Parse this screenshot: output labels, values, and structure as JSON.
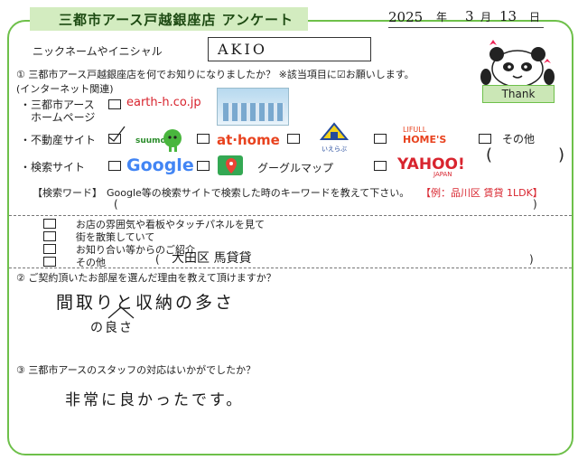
{
  "header": {
    "title": "三都市アース戸越銀座店 アンケート",
    "date_year": "2025",
    "date_year_unit": "年",
    "date_month": "3",
    "date_month_unit": "月",
    "date_day": "13",
    "date_day_unit": "日"
  },
  "nickname": {
    "label": "ニックネームやイニシャル",
    "value": "AKIO"
  },
  "mascot": {
    "badge": "Thank"
  },
  "q1": {
    "question": "① 三都市アース戸越銀座店を何でお知りになりましたか？ ※該当項目に☑お願いします。",
    "internet_label": "(インターネット関連)",
    "homepage_label_1": "・三都市アース",
    "homepage_label_2": "ホームページ",
    "homepage_site": "earth-h.co.jp",
    "realestate_label": "・不動産サイト",
    "suumo": "suumo",
    "athome": "at·home",
    "ieichi": "いえらぶ",
    "lifull_1": "LIFULL",
    "lifull_2": "HOME'S",
    "other_label": "その他",
    "paren_open": "(",
    "paren_close": ")",
    "search_label": "・検索サイト",
    "google": "Google",
    "googlemap": "グーグルマップ",
    "yahoo": "YAHOO!",
    "yahoo_sub": "JAPAN",
    "keyword_label": "【検索ワード】",
    "keyword_desc": "Google等の検索サイトで検索した時のキーワードを教えて下さい。",
    "keyword_example": "【例：品川区 賃貸 1LDK】",
    "offline": [
      {
        "label": "お店の雰囲気や看板やタッチパネルを見て"
      },
      {
        "label": "街を散策していて"
      },
      {
        "label": "お知り合い等からのご紹介"
      },
      {
        "label": "その他"
      }
    ],
    "other_answer": "大田区 馬貸貸"
  },
  "q2": {
    "question": "② ご契約頂いたお部屋を選んだ理由を教えて頂けますか？",
    "answer_line1": "間取りと収納の多さ",
    "answer_line2": "の良さ"
  },
  "q3": {
    "question": "③ 三都市アースのスタッフの対応はいかがでしたか？",
    "answer": "非常に良かったです。"
  },
  "colors": {
    "frame": "#6ec04a",
    "title_bg": "#d3ecc0",
    "keyword_example": "#d8242e"
  }
}
